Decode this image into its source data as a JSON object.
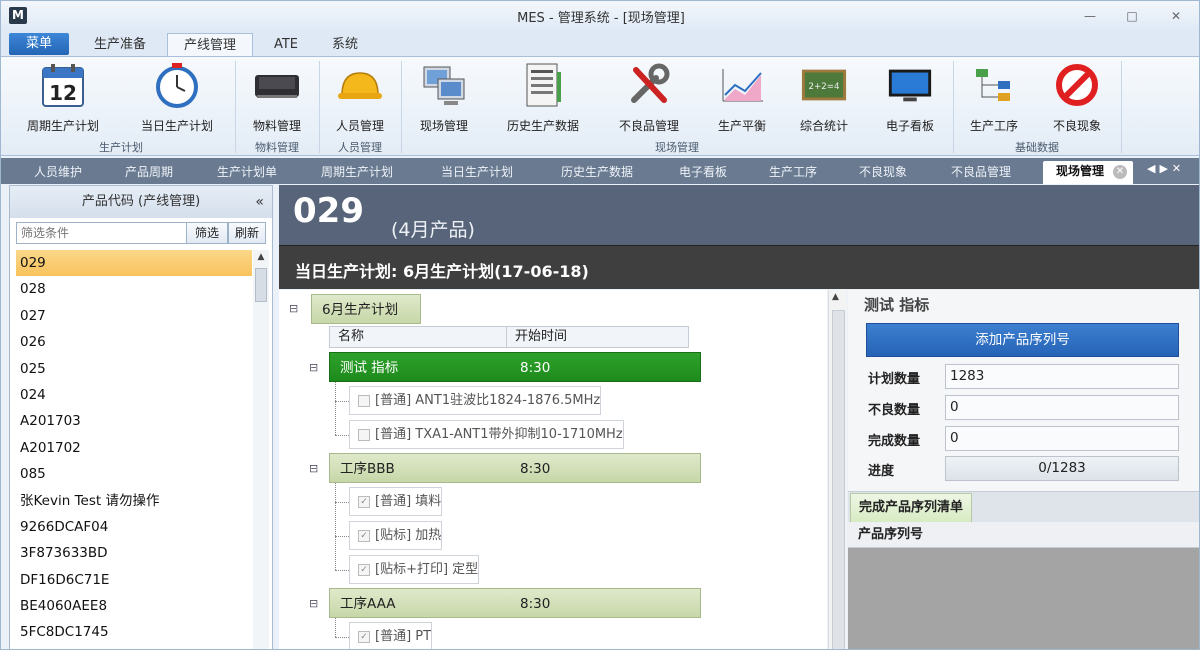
{
  "window": {
    "title": "MES - 管理系统 - [现场管理]",
    "logo": "M"
  },
  "ribbon_tabs": [
    {
      "label": "菜单"
    },
    {
      "label": "生产准备"
    },
    {
      "label": "产线管理"
    },
    {
      "label": "ATE"
    },
    {
      "label": "系统"
    }
  ],
  "ribbon": {
    "buttons": [
      {
        "label": "周期生产计划",
        "icon": "calendar-icon"
      },
      {
        "label": "当日生产计划",
        "icon": "clock-icon"
      },
      {
        "label": "物料管理",
        "icon": "chip-icon"
      },
      {
        "label": "人员管理",
        "icon": "hardhat-icon"
      },
      {
        "label": "现场管理",
        "icon": "computers-icon"
      },
      {
        "label": "历史生产数据",
        "icon": "document-icon"
      },
      {
        "label": "不良品管理",
        "icon": "tools-icon"
      },
      {
        "label": "生产平衡",
        "icon": "chart-icon"
      },
      {
        "label": "综合统计",
        "icon": "chalkboard-icon"
      },
      {
        "label": "电子看板",
        "icon": "monitor-icon"
      },
      {
        "label": "生产工序",
        "icon": "flow-icon"
      },
      {
        "label": "不良现象",
        "icon": "prohibited-icon"
      }
    ],
    "groups": [
      "生产计划",
      "物料管理",
      "人员管理",
      "现场管理",
      "基础数据"
    ]
  },
  "doc_tabs": [
    "人员维护",
    "产品周期",
    "生产计划单",
    "周期生产计划",
    "当日生产计划",
    "历史生产数据",
    "电子看板",
    "生产工序",
    "不良现象",
    "不良品管理",
    "现场管理"
  ],
  "left_panel": {
    "title": "产品代码 (产线管理)",
    "collapse_glyph": "«",
    "filter_placeholder": "筛选条件",
    "filter_button": "筛选",
    "refresh_button": "刷新",
    "items": [
      "029",
      "028",
      "027",
      "026",
      "025",
      "024",
      "A201703",
      "A201702",
      "085",
      "张Kevin  Test 请勿操作",
      "9266DCAF04",
      "3F873633BD",
      "DF16D6C71E",
      "BE4060AEE8",
      "5FC8DC1745"
    ],
    "selected_index": 0
  },
  "main": {
    "product_code": "029",
    "product_desc": "(4月产品)",
    "plan_title": "当日生产计划: 6月生产计划(17-06-18)",
    "tree_root": "6月生产计划",
    "col_name": "名称",
    "col_start": "开始时间",
    "processes": [
      {
        "name": "测试 指标",
        "time": "8:30",
        "steps": [
          "[普通] ANT1驻波比1824-1876.5MHz",
          "[普通] TXA1-ANT1带外抑制10-1710MHz"
        ]
      },
      {
        "name": "工序BBB",
        "time": "8:30",
        "steps": [
          "[普通] 填料",
          "[贴标] 加热",
          "[贴标+打印] 定型"
        ]
      },
      {
        "name": "工序AAA",
        "time": "8:30",
        "steps": [
          "[普通] PT"
        ]
      }
    ]
  },
  "right_panel": {
    "title": "测试 指标",
    "add_button": "添加产品序列号",
    "planned_label": "计划数量",
    "planned_value": "1283",
    "defect_label": "不良数量",
    "defect_value": "0",
    "done_label": "完成数量",
    "done_value": "0",
    "progress_label": "进度",
    "progress_text": "0/1283",
    "progress_fraction": 0,
    "tab_label": "完成产品序列清单",
    "grid_header": "产品序列号"
  }
}
